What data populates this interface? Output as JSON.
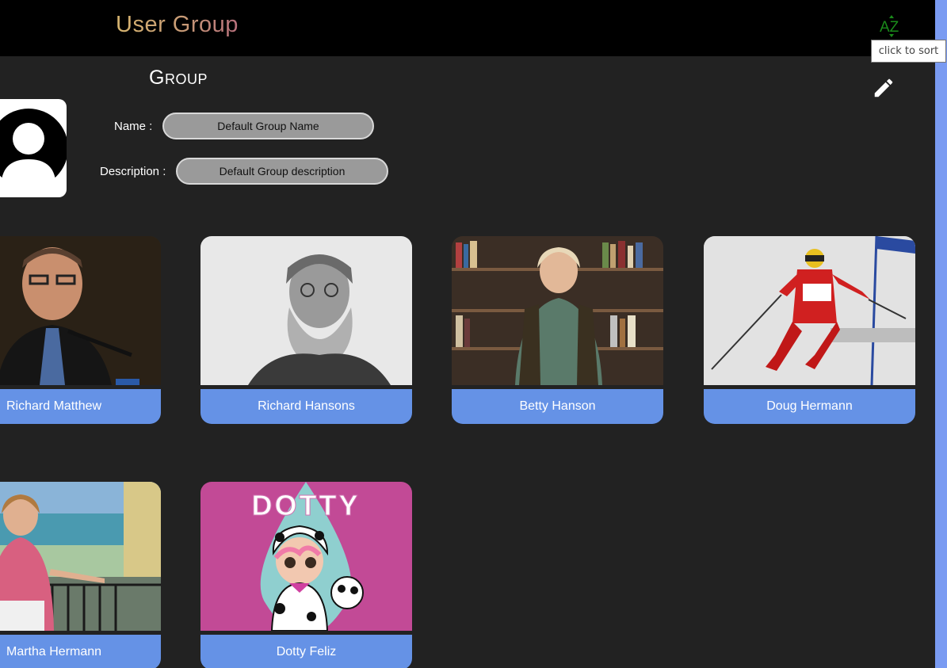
{
  "header": {
    "title": "User Group",
    "sort_icon_text": "AZ",
    "sort_tooltip": "click to sort"
  },
  "group": {
    "heading": "Group",
    "name_label": "Name :",
    "name_value": "Default Group Name",
    "description_label": "Description :",
    "description_value": "Default Group description"
  },
  "members": [
    {
      "name": "Richard Matthew"
    },
    {
      "name": "Richard Hansons"
    },
    {
      "name": "Betty Hanson"
    },
    {
      "name": "Doug Hermann"
    },
    {
      "name": "Martha Hermann"
    },
    {
      "name": "Dotty Feliz"
    }
  ],
  "dotty_logo_text": "DOTTY",
  "colors": {
    "header_bg": "#000000",
    "page_bg": "#222222",
    "card_name_bar": "#6592e6",
    "scrollbar": "#7a9bf2",
    "sort_icon": "#1a8a1a"
  },
  "icons": {
    "sort": "az-sort-icon",
    "edit": "pencil-icon",
    "group_avatar": "person-placeholder-icon"
  }
}
